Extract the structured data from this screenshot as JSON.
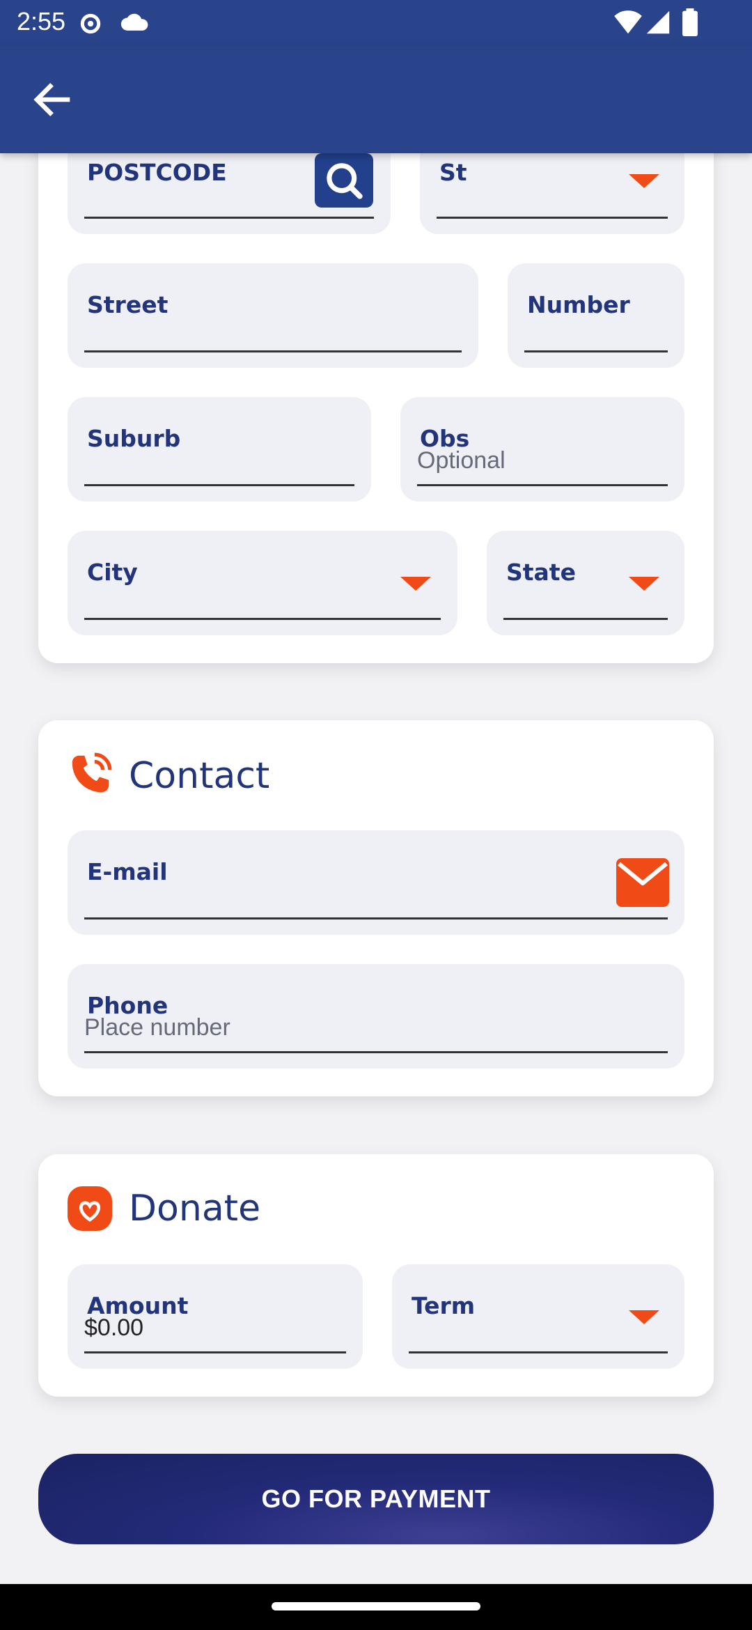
{
  "status_bar": {
    "time": "2:55"
  },
  "app_bar": {
    "back_icon": "arrow-left-icon"
  },
  "address": {
    "postcode": {
      "label": "POSTCODE",
      "value": ""
    },
    "st": {
      "label": "St",
      "value": ""
    },
    "street": {
      "label": "Street",
      "value": ""
    },
    "number": {
      "label": "Number",
      "value": ""
    },
    "suburb": {
      "label": "Suburb",
      "value": ""
    },
    "obs": {
      "label": "Obs",
      "placeholder": "Optional"
    },
    "city": {
      "label": "City",
      "value": ""
    },
    "state": {
      "label": "State",
      "value": ""
    }
  },
  "contact": {
    "title": "Contact",
    "email": {
      "label": "E-mail",
      "value": ""
    },
    "phone": {
      "label": "Phone",
      "placeholder": "Place number"
    }
  },
  "donate": {
    "title": "Donate",
    "amount": {
      "label": "Amount",
      "value": "$0.00"
    },
    "term": {
      "label": "Term",
      "value": ""
    }
  },
  "pay_button": {
    "label": "GO FOR PAYMENT"
  },
  "colors": {
    "primary": "#2a448c",
    "accent": "#f04a17",
    "field_bg": "#efeff6",
    "label": "#22347a"
  }
}
